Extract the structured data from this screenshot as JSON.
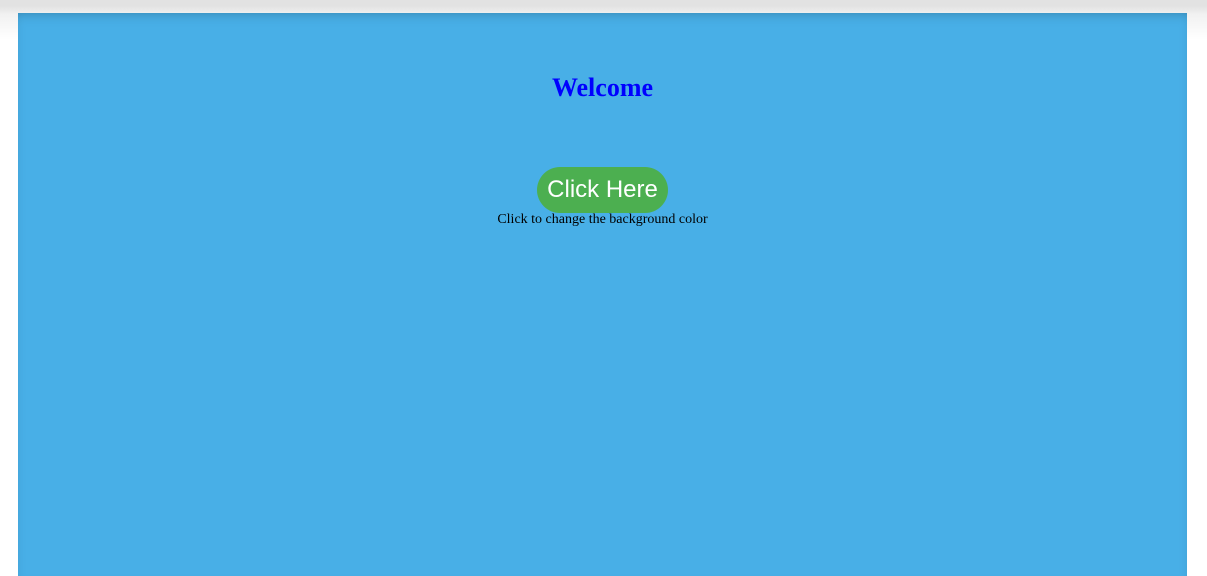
{
  "page": {
    "background_color": "#48afe7",
    "heading": {
      "text": "Welcome",
      "color": "#0000ff"
    },
    "button": {
      "label": "Click Here",
      "color": "#4caf50",
      "text_color": "#ffffff"
    },
    "hint_text": "Click to change the background color"
  }
}
